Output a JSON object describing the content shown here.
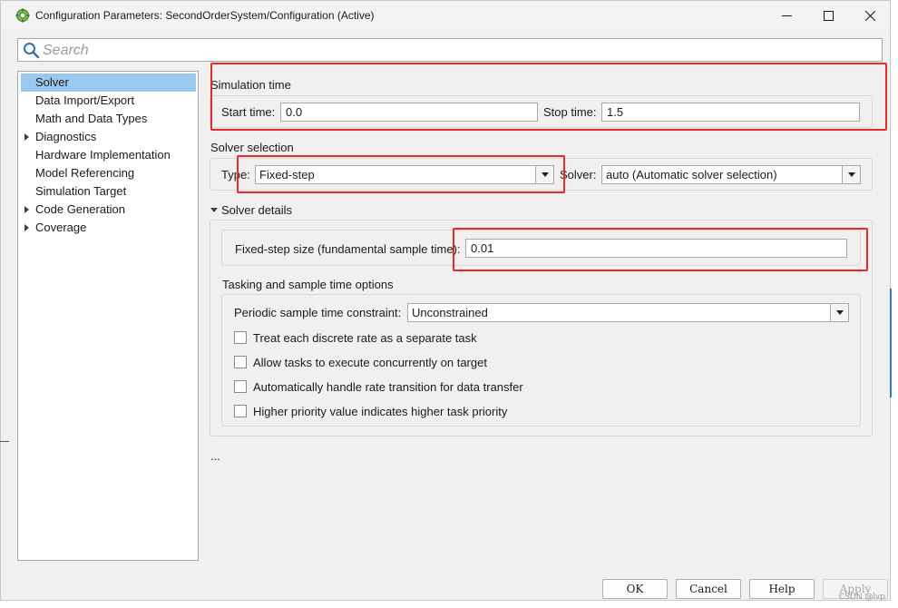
{
  "window": {
    "title": "Configuration Parameters: SecondOrderSystem/Configuration (Active)",
    "buttons": {
      "minimize": "minimize-icon",
      "maximize": "maximize-icon",
      "close": "close-icon"
    }
  },
  "search": {
    "placeholder": "Search",
    "value": ""
  },
  "tree": {
    "items": [
      {
        "label": "Solver",
        "selected": true,
        "expandable": false
      },
      {
        "label": "Data Import/Export",
        "selected": false,
        "expandable": false
      },
      {
        "label": "Math and Data Types",
        "selected": false,
        "expandable": false
      },
      {
        "label": "Diagnostics",
        "selected": false,
        "expandable": true
      },
      {
        "label": "Hardware Implementation",
        "selected": false,
        "expandable": false
      },
      {
        "label": "Model Referencing",
        "selected": false,
        "expandable": false
      },
      {
        "label": "Simulation Target",
        "selected": false,
        "expandable": false
      },
      {
        "label": "Code Generation",
        "selected": false,
        "expandable": true
      },
      {
        "label": "Coverage",
        "selected": false,
        "expandable": true
      }
    ]
  },
  "simulation_time": {
    "heading": "Simulation time",
    "start_label": "Start time:",
    "start_value": "0.0",
    "stop_label": "Stop time:",
    "stop_value": "1.5"
  },
  "solver_selection": {
    "heading": "Solver selection",
    "type_label": "Type:",
    "type_value": "Fixed-step",
    "solver_label": "Solver:",
    "solver_value": "auto (Automatic solver selection)"
  },
  "solver_details": {
    "heading": "Solver details",
    "step_size_label": "Fixed-step size (fundamental sample time):",
    "step_size_value": "0.01"
  },
  "tasking": {
    "heading": "Tasking and sample time options",
    "constraint_label": "Periodic sample time constraint:",
    "constraint_value": "Unconstrained",
    "checkboxes": [
      {
        "label": "Treat each discrete rate as a separate task",
        "checked": false
      },
      {
        "label": "Allow tasks to execute concurrently on target",
        "checked": false
      },
      {
        "label": "Automatically handle rate transition for data transfer",
        "checked": false
      },
      {
        "label": "Higher priority value indicates higher task priority",
        "checked": false
      }
    ]
  },
  "more": "...",
  "footer": {
    "ok": "OK",
    "cancel": "Cancel",
    "help": "Help",
    "apply": "Apply"
  },
  "watermark": "CSDN @lvp",
  "colors": {
    "window_bg": "#f0f0f0",
    "selection": "#99c9ef",
    "highlight_border": "#e8282a"
  }
}
